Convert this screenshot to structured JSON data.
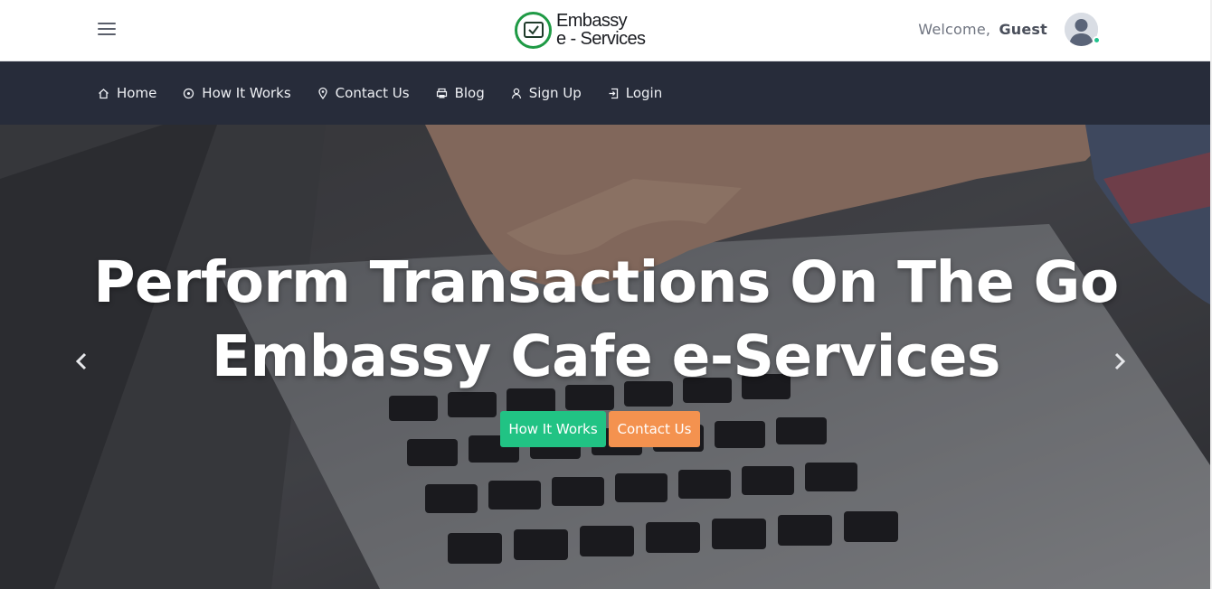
{
  "header": {
    "menu_icon": "hamburger-menu-icon",
    "logo": {
      "line1": "Embassy",
      "line2": "e - Services",
      "icon": "envelope-check-icon",
      "accent": "#1f9a45"
    },
    "welcome_label": "Welcome,",
    "user_name": "Guest",
    "avatar_icon": "user-avatar-icon",
    "status": "online",
    "status_color": "#22c38e"
  },
  "nav": {
    "background": "#272c3a",
    "items": [
      {
        "label": "Home",
        "icon": "home-icon"
      },
      {
        "label": "How It Works",
        "icon": "info-circle-icon"
      },
      {
        "label": "Contact Us",
        "icon": "map-pin-icon"
      },
      {
        "label": "Blog",
        "icon": "printer-icon"
      },
      {
        "label": "Sign Up",
        "icon": "user-icon"
      },
      {
        "label": "Login",
        "icon": "login-icon"
      }
    ]
  },
  "hero": {
    "title_line1": "Perform Transactions On The Go",
    "title_line2": "Embassy Cafe e-Services",
    "buttons": [
      {
        "label": "How It Works",
        "color": "#21c384"
      },
      {
        "label": "Contact Us",
        "color": "#f4924f"
      }
    ],
    "prev_icon": "chevron-left-icon",
    "next_icon": "chevron-right-icon",
    "background_image": "hands typing on laptop keyboard"
  }
}
